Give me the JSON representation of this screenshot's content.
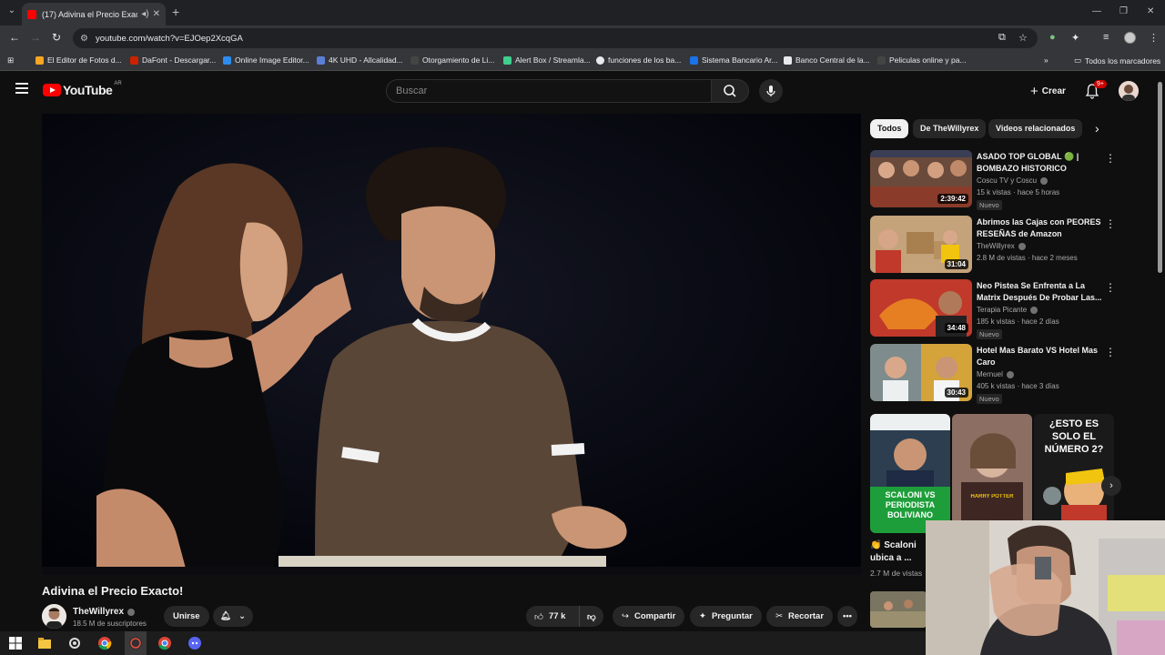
{
  "browser": {
    "tab_title": "(17) Adivina el Precio Exacto!",
    "url": "youtube.com/watch?v=EJOep2XcqGA",
    "new_tab": "+",
    "bookmarks": [
      {
        "label": "El Editor de Fotos d...",
        "color": "#f5a623"
      },
      {
        "label": "DaFont - Descargar...",
        "color": "#cc2200"
      },
      {
        "label": "Online Image Editor...",
        "color": "#2d8cf0"
      },
      {
        "label": "4K UHD - Allcalidad...",
        "color": "#5b7fd6"
      },
      {
        "label": "Otorgamiento de Li...",
        "color": "#444444"
      },
      {
        "label": "Alert Box / Streamla...",
        "color": "#3fcf8e"
      },
      {
        "label": "funciones de los ba...",
        "color": "#e8eaed"
      },
      {
        "label": "Sistema Bancario Ar...",
        "color": "#1a73e8"
      },
      {
        "label": "Banco Central de la...",
        "color": "#e8eaed"
      },
      {
        "label": "Peliculas online y pa...",
        "color": "#444444"
      }
    ],
    "all_bookmarks": "Todos los marcadores"
  },
  "youtube": {
    "logo_text": "YouTube",
    "country_code": "AR",
    "search_placeholder": "Buscar",
    "create_label": "Crear",
    "notif_badge": "9+"
  },
  "video": {
    "title": "Adivina el Precio Exacto!",
    "channel": "TheWillyrex",
    "subscribers": "18.5 M de suscriptores",
    "join_label": "Unirse",
    "likes": "77 k",
    "share_label": "Compartir",
    "ask_label": "Preguntar",
    "clip_label": "Recortar"
  },
  "chips": [
    "Todos",
    "De TheWillyrex",
    "Videos relacionados"
  ],
  "recommendations": [
    {
      "title": "ASADO TOP GLOBAL 🟢 | BOMBAZO HISTORICO",
      "channel": "Coscu TV y Coscu",
      "meta": "15 k vistas · hace 5 horas",
      "duration": "2:39:42",
      "badge": "Nuevo"
    },
    {
      "title": "Abrimos las Cajas con PEORES RESEÑAS de Amazon",
      "channel": "TheWillyrex",
      "meta": "2.8 M de vistas · hace 2 meses",
      "duration": "31:04",
      "badge": ""
    },
    {
      "title": "Neo Pistea Se Enfrenta a La Matrix Después De Probar Las...",
      "channel": "Terapia Picante",
      "meta": "185 k vistas · hace 2 días",
      "duration": "34:48",
      "badge": "Nuevo"
    },
    {
      "title": "Hotel Mas Barato VS Hotel Mas Caro",
      "channel": "Mernuel",
      "meta": "405 k vistas · hace 3 días",
      "duration": "30:43",
      "badge": "Nuevo"
    }
  ],
  "shorts": {
    "thumb_texts": [
      "SCALONI VS PERIODISTA BOLIVIANO",
      "HARRY POTTER",
      "¿ESTO ES SOLO EL NÚMERO 2?"
    ],
    "first_title": "👏 Scaloni ubica a ...",
    "first_views": "2.7 M de vistas"
  },
  "colors": {
    "accent_red": "#ff0000",
    "bg": "#0f0f0f",
    "chip_bg": "#272727"
  }
}
